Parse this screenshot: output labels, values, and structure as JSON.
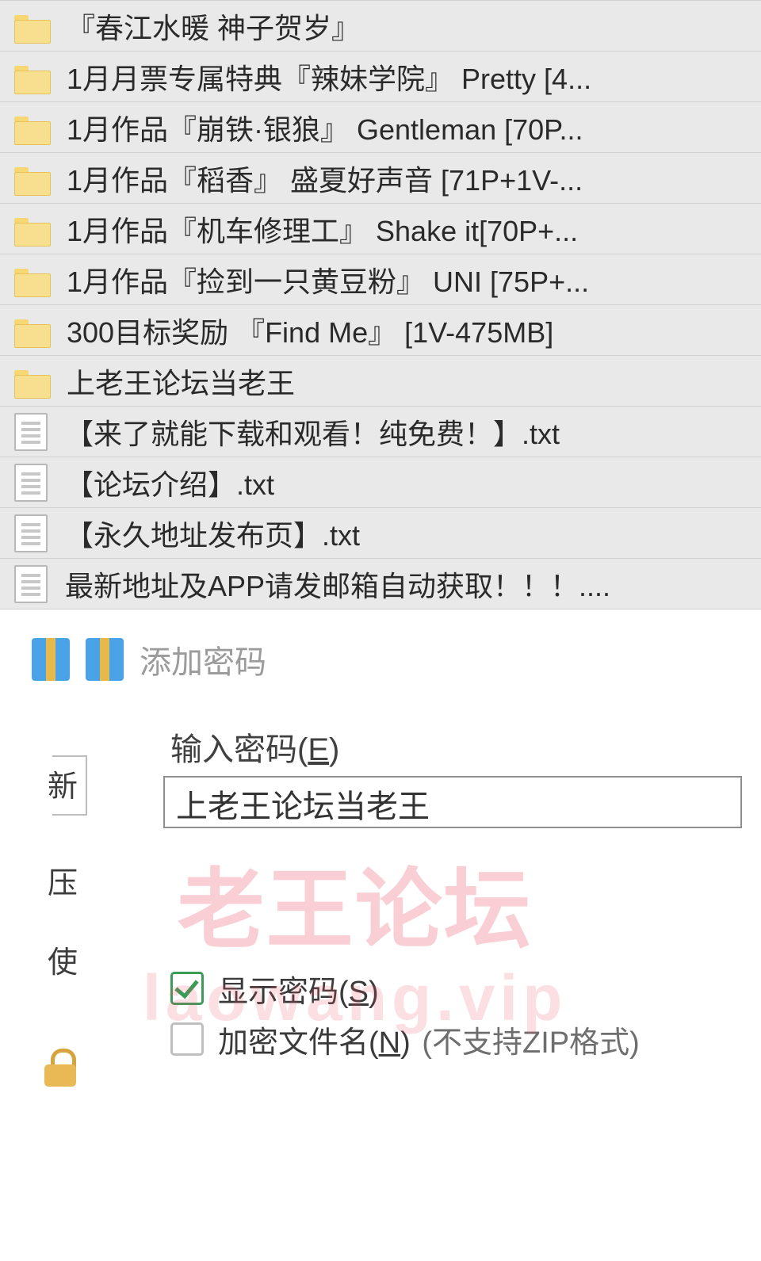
{
  "files": [
    {
      "type": "folder",
      "name": "『春江水暖 神子贺岁』"
    },
    {
      "type": "folder",
      "name": "1月月票专属特典『辣妹学院』 Pretty [4..."
    },
    {
      "type": "folder",
      "name": "1月作品『崩铁·银狼』 Gentleman [70P..."
    },
    {
      "type": "folder",
      "name": "1月作品『稻香』 盛夏好声音 [71P+1V-..."
    },
    {
      "type": "folder",
      "name": "1月作品『机车修理工』 Shake it[70P+..."
    },
    {
      "type": "folder",
      "name": "1月作品『捡到一只黄豆粉』 UNI [75P+..."
    },
    {
      "type": "folder",
      "name": "300目标奖励 『Find Me』 [1V-475MB]"
    },
    {
      "type": "folder",
      "name": "上老王论坛当老王"
    },
    {
      "type": "txt",
      "name": "【来了就能下载和观看！纯免费！】.txt"
    },
    {
      "type": "txt",
      "name": "【论坛介绍】.txt"
    },
    {
      "type": "txt",
      "name": "【永久地址发布页】.txt"
    },
    {
      "type": "txt",
      "name": "最新地址及APP请发邮箱自动获取！！！...."
    }
  ],
  "dialog": {
    "title": "添加密码",
    "password_label_prefix": "输入密码(",
    "password_label_hotkey": "E",
    "password_label_suffix": ")",
    "password_value": "上老王论坛当老王",
    "side_fragments": {
      "f1": "新",
      "f2": "压",
      "f3": "使"
    },
    "show_pwd_prefix": "显示密码(",
    "show_pwd_hotkey": "S",
    "show_pwd_suffix": ")",
    "show_pwd_checked": true,
    "encrypt_prefix": "加密文件名(",
    "encrypt_hotkey": "N",
    "encrypt_suffix": ")",
    "encrypt_checked": false,
    "encrypt_note": " (不支持ZIP格式)"
  },
  "watermark": {
    "line1": "老王论坛",
    "line2": "laowang.vip"
  }
}
